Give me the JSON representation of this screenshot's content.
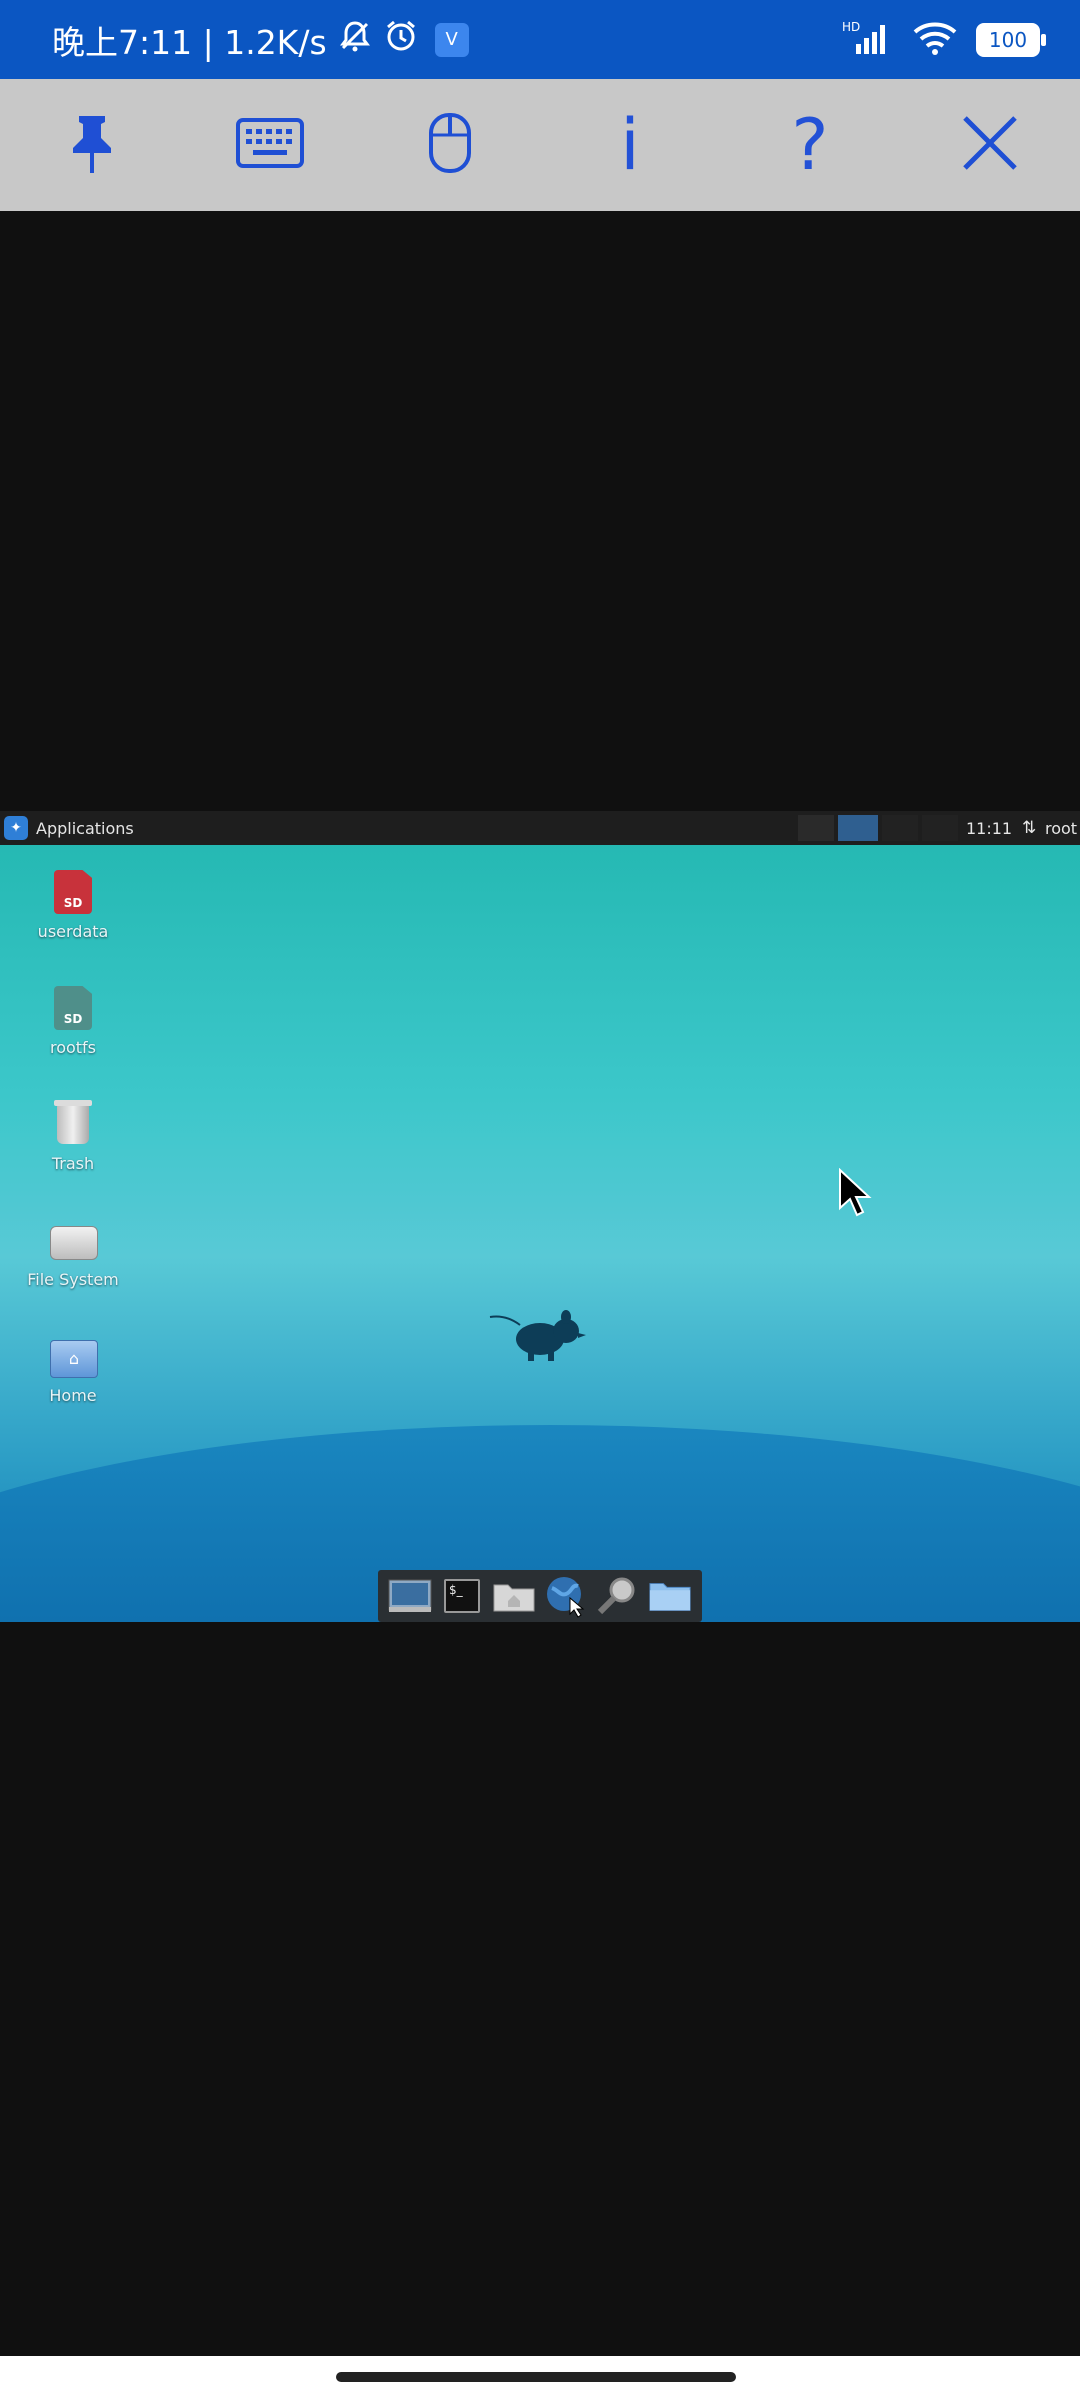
{
  "status_bar": {
    "time_speed": "晚上7:11 | 1.2K/s",
    "vpn_badge": "V⃣",
    "network_label": "HD",
    "battery": "100"
  },
  "toolbar": {
    "buttons": [
      "pin-icon",
      "keyboard-icon",
      "mouse-icon",
      "info-icon",
      "help-icon",
      "close-icon"
    ],
    "info_label": "i",
    "help_label": "?"
  },
  "desktop": {
    "panel": {
      "menu_label": "Applications",
      "clock": "11:11",
      "net_symbol": "⇅",
      "user": "root"
    },
    "icons": [
      {
        "label": "userdata",
        "icon": "sd-card-icon"
      },
      {
        "label": "rootfs",
        "icon": "sd-card-icon"
      },
      {
        "label": "Trash",
        "icon": "trash-icon"
      },
      {
        "label": "File System",
        "icon": "drive-icon"
      },
      {
        "label": "Home",
        "icon": "home-folder-icon"
      }
    ],
    "dock": [
      "show-desktop-icon",
      "terminal-icon",
      "file-manager-icon",
      "web-browser-icon",
      "app-finder-icon",
      "folder-icon"
    ],
    "terminal_glyph": "$_"
  },
  "colors": {
    "status_bar": "#0b56c2",
    "toolbar_bg": "#c8c8c8",
    "toolbar_icon": "#1f4fd4",
    "outer_bg": "#101010"
  }
}
